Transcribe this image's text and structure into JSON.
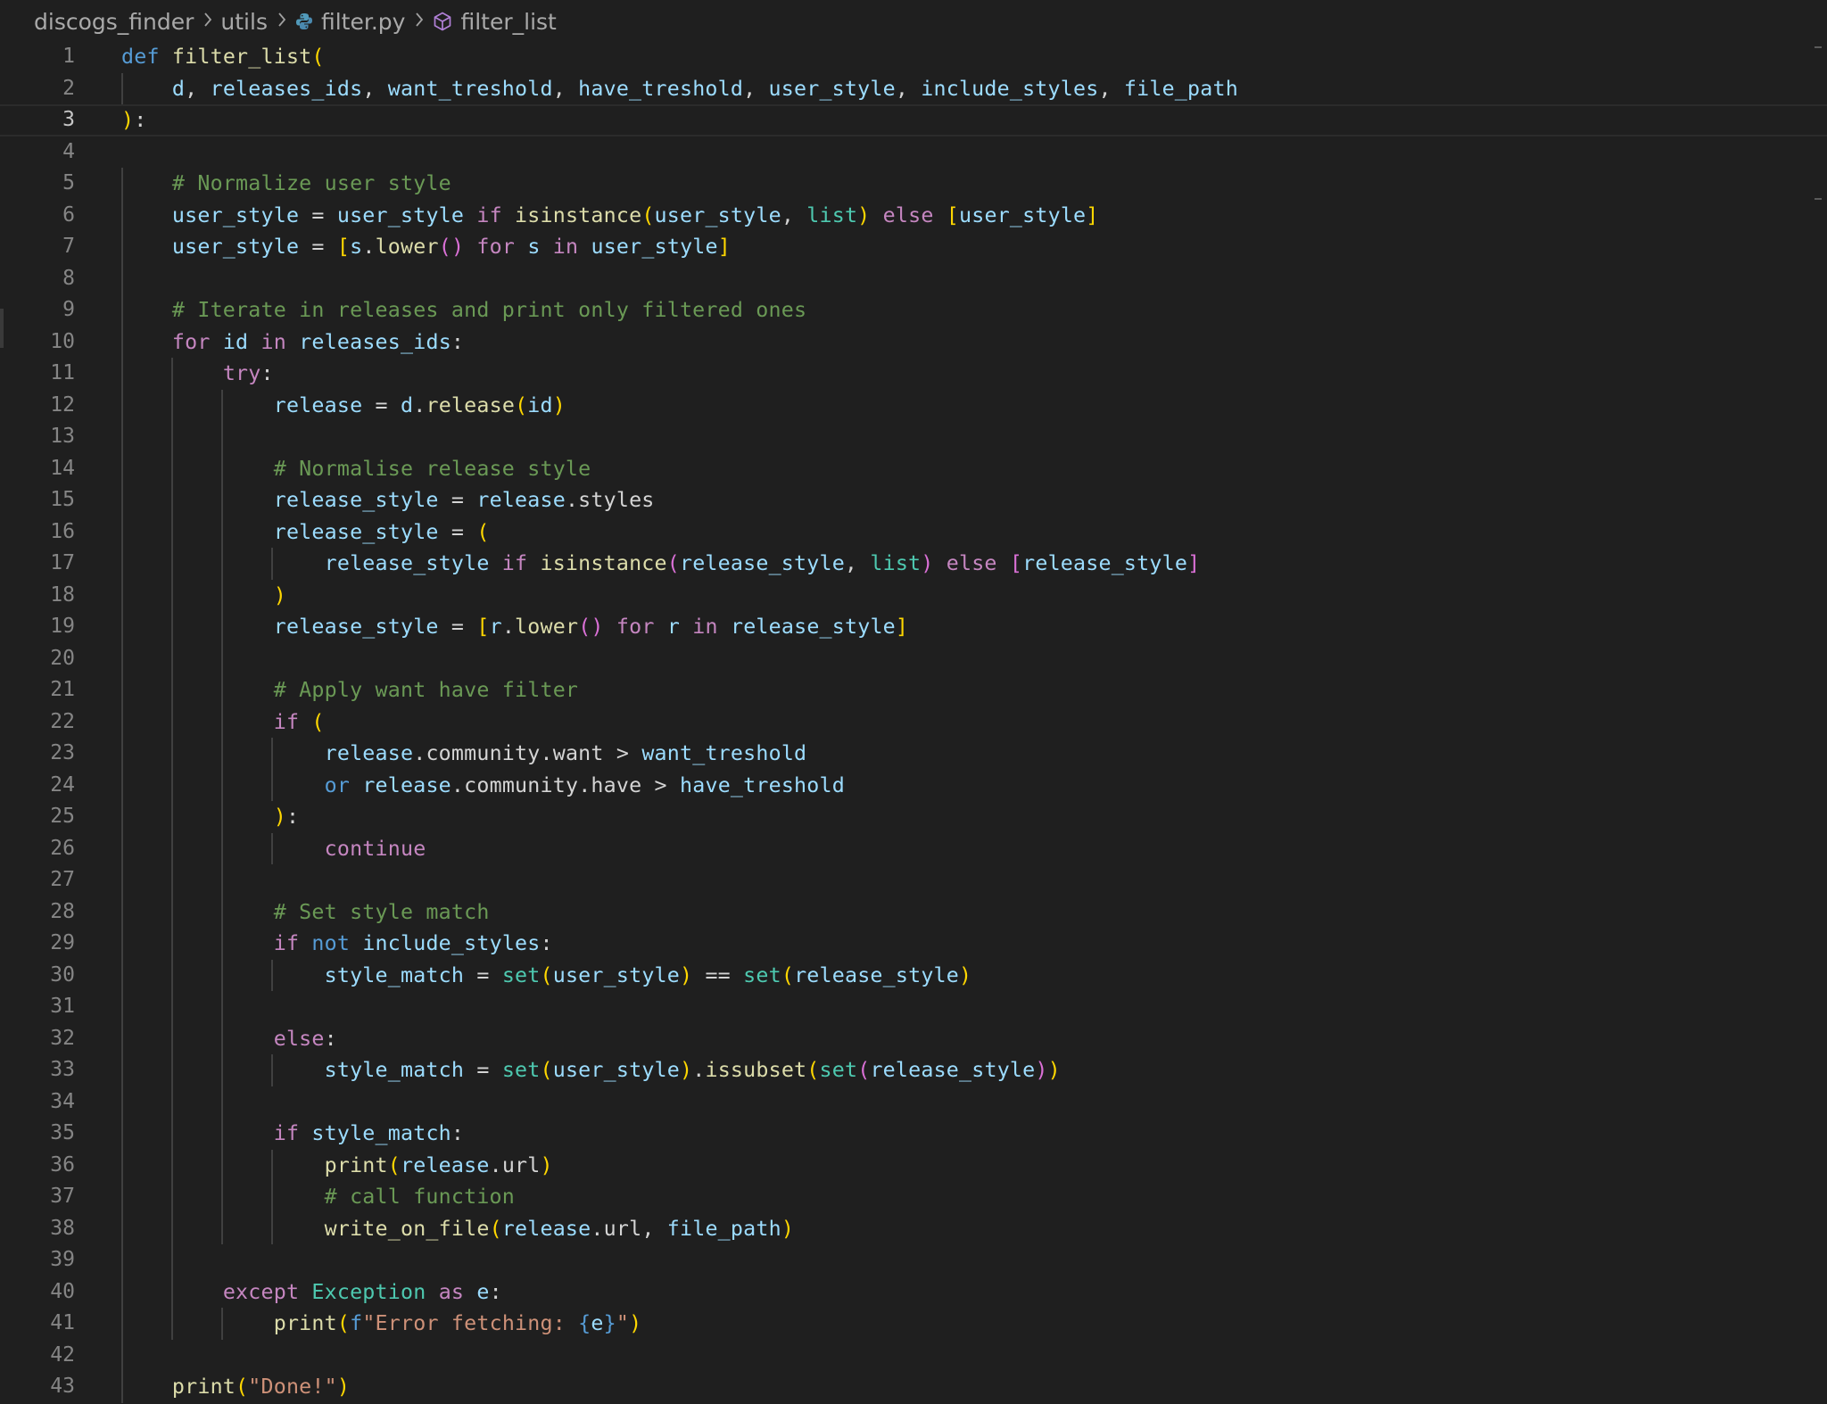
{
  "breadcrumb": {
    "items": [
      {
        "label": "discogs_finder",
        "icon": null
      },
      {
        "label": "utils",
        "icon": null
      },
      {
        "label": "filter.py",
        "icon": "python-file-icon"
      },
      {
        "label": "filter_list",
        "icon": "symbol-function-icon"
      }
    ]
  },
  "editor": {
    "language": "python",
    "current_line": 3,
    "colors": {
      "background": "#1f1f1f",
      "keyword": "#569cd6",
      "control": "#c586c0",
      "function": "#dcdcaa",
      "variable": "#9cdcfe",
      "class": "#4ec9b0",
      "string": "#ce9178",
      "comment": "#6a9955",
      "bracket_1": "#ffd700",
      "bracket_2": "#da70d6",
      "bracket_3": "#179fff"
    },
    "lines": [
      "def filter_list(",
      "    d, releases_ids, want_treshold, have_treshold, user_style, include_styles, file_path",
      "):",
      "",
      "    # Normalize user style",
      "    user_style = user_style if isinstance(user_style, list) else [user_style]",
      "    user_style = [s.lower() for s in user_style]",
      "",
      "    # Iterate in releases and print only filtered ones",
      "    for id in releases_ids:",
      "        try:",
      "            release = d.release(id)",
      "",
      "            # Normalise release style",
      "            release_style = release.styles",
      "            release_style = (",
      "                release_style if isinstance(release_style, list) else [release_style]",
      "            )",
      "            release_style = [r.lower() for r in release_style]",
      "",
      "            # Apply want have filter",
      "            if (",
      "                release.community.want > want_treshold",
      "                or release.community.have > have_treshold",
      "            ):",
      "                continue",
      "",
      "            # Set style match",
      "            if not include_styles:",
      "                style_match = set(user_style) == set(release_style)",
      "",
      "            else:",
      "                style_match = set(user_style).issubset(set(release_style))",
      "",
      "            if style_match:",
      "                print(release.url)",
      "                # call function",
      "                write_on_file(release.url, file_path)",
      "",
      "        except Exception as e:",
      "            print(f\"Error fetching: {e}\")",
      "",
      "    print(\"Done!\")"
    ]
  }
}
